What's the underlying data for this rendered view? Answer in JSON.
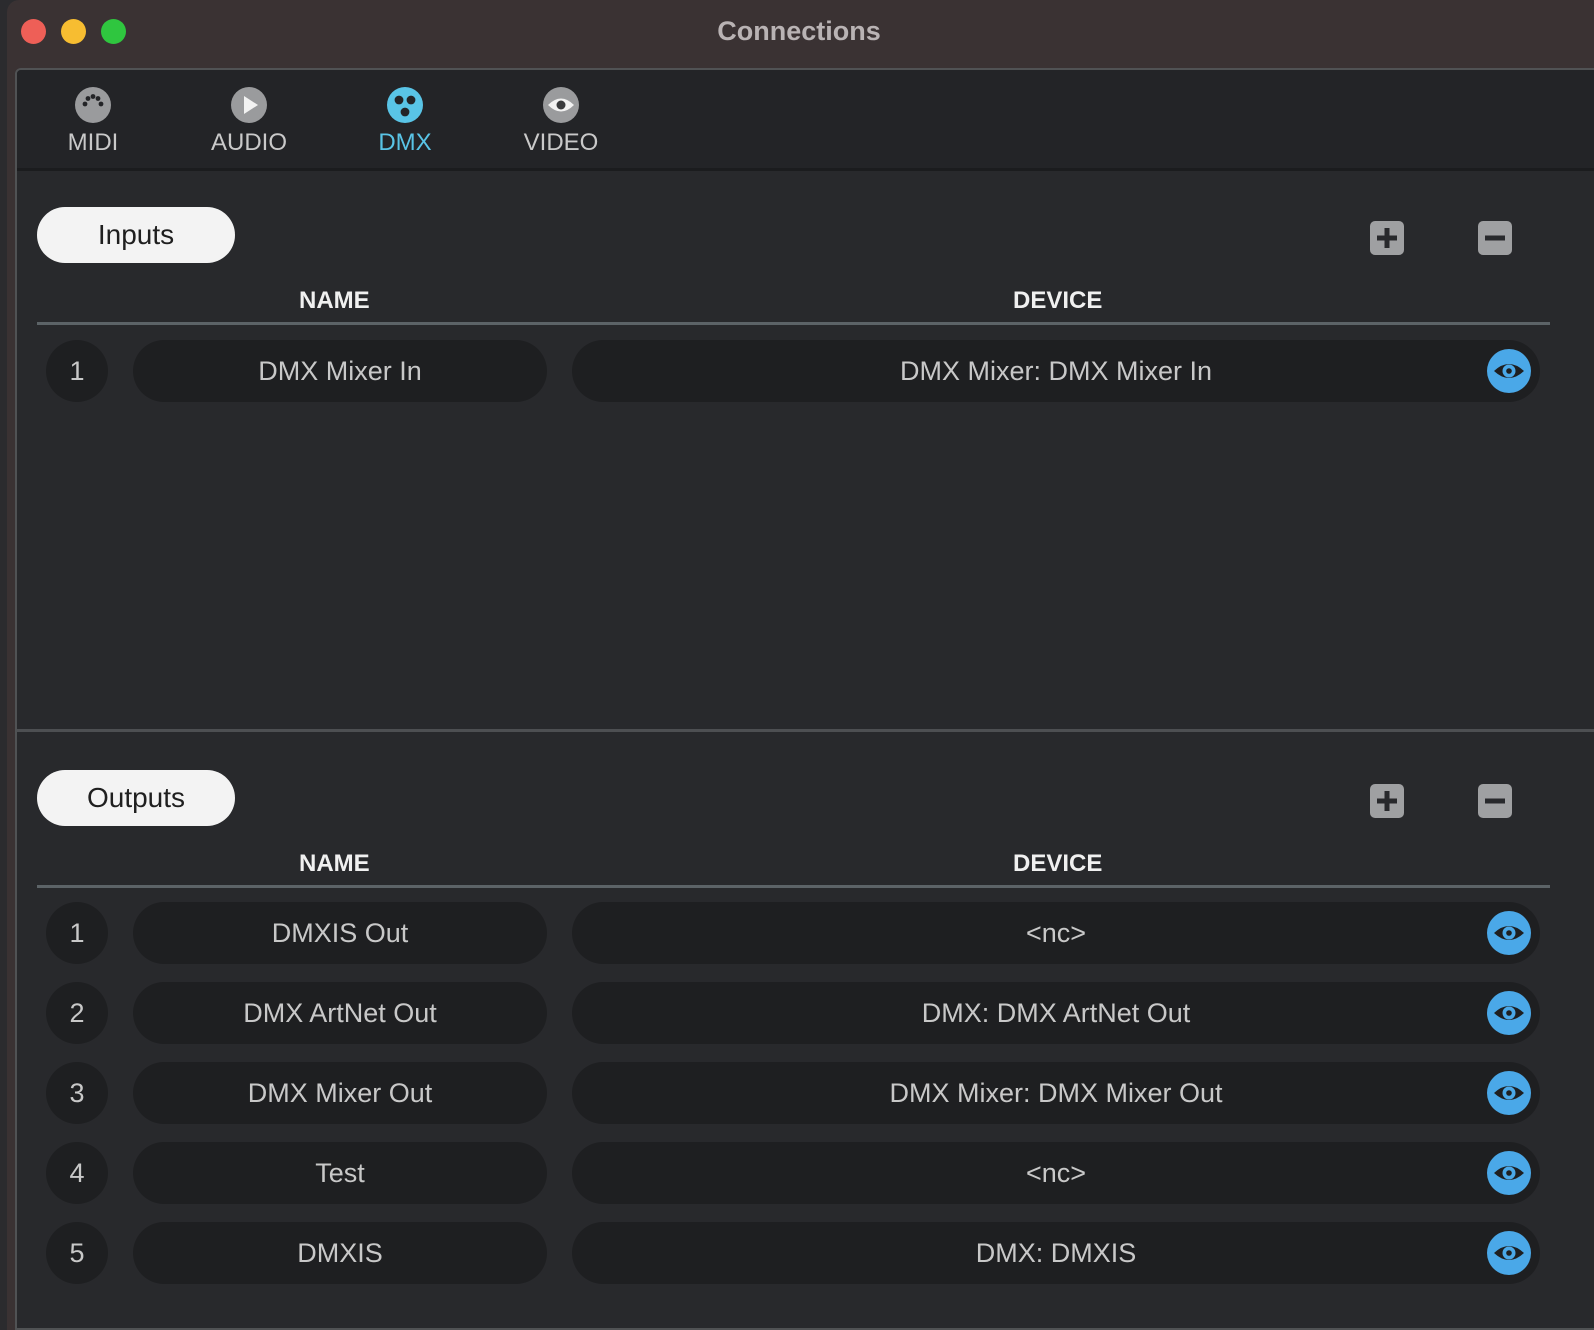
{
  "window": {
    "title": "Connections"
  },
  "tabs": [
    {
      "label": "MIDI",
      "icon": "midi-port-icon",
      "active": false
    },
    {
      "label": "AUDIO",
      "icon": "play-icon",
      "active": false
    },
    {
      "label": "DMX",
      "icon": "dmx-connector-icon",
      "active": true
    },
    {
      "label": "VIDEO",
      "icon": "eye-icon",
      "active": false
    }
  ],
  "inputs": {
    "label": "Inputs",
    "columns": {
      "name": "NAME",
      "device": "DEVICE"
    },
    "rows": [
      {
        "index": "1",
        "name": "DMX Mixer In",
        "device": "DMX Mixer: DMX Mixer In"
      }
    ]
  },
  "outputs": {
    "label": "Outputs",
    "columns": {
      "name": "NAME",
      "device": "DEVICE"
    },
    "rows": [
      {
        "index": "1",
        "name": "DMXIS Out",
        "device": "<nc>"
      },
      {
        "index": "2",
        "name": "DMX ArtNet Out",
        "device": "DMX: DMX ArtNet Out"
      },
      {
        "index": "3",
        "name": "DMX Mixer Out",
        "device": "DMX Mixer: DMX Mixer Out"
      },
      {
        "index": "4",
        "name": "Test",
        "device": "<nc>"
      },
      {
        "index": "5",
        "name": "DMXIS",
        "device": "DMX: DMXIS"
      }
    ]
  },
  "colors": {
    "accent": "#59c4e6",
    "eye": "#4aa8e8",
    "background": "#28292c",
    "field": "#1e1f21"
  }
}
